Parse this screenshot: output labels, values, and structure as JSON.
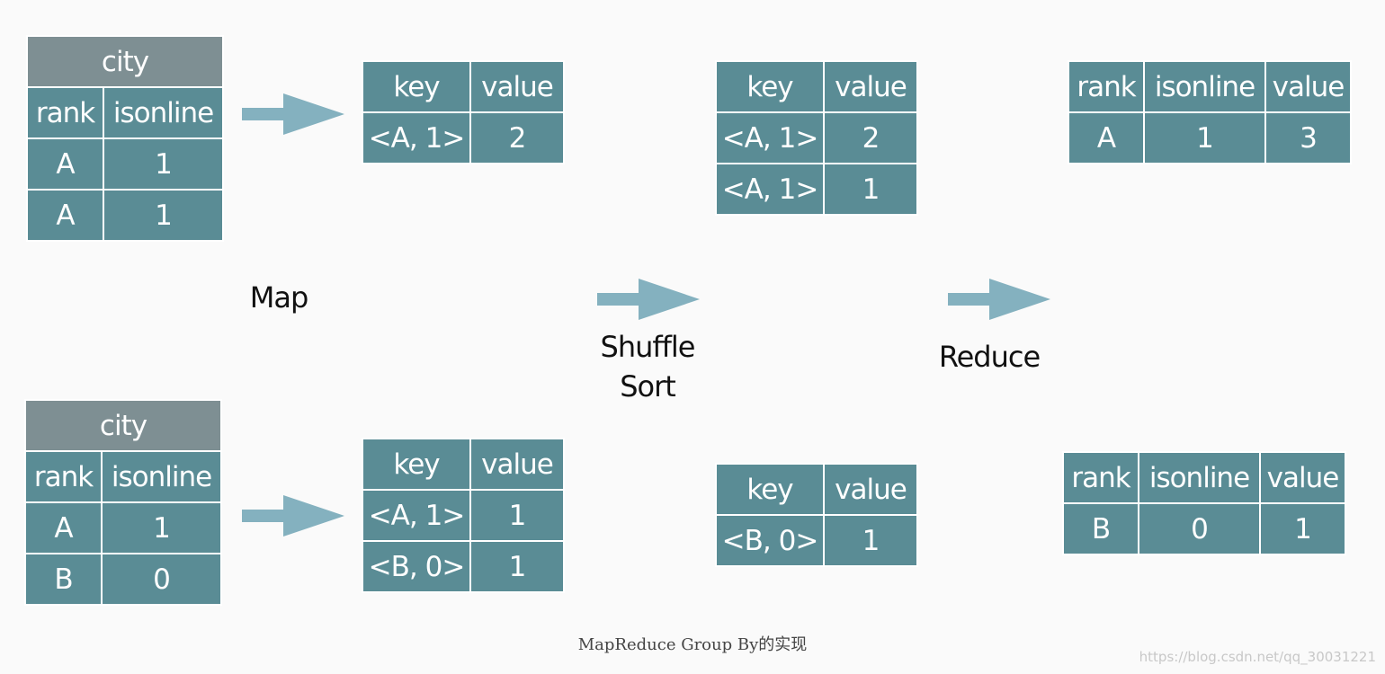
{
  "input_table_1": {
    "title": "city",
    "headers": [
      "rank",
      "isonline"
    ],
    "rows": [
      [
        "A",
        "1"
      ],
      [
        "A",
        "1"
      ]
    ]
  },
  "input_table_2": {
    "title": "city",
    "headers": [
      "rank",
      "isonline"
    ],
    "rows": [
      [
        "A",
        "1"
      ],
      [
        "B",
        "0"
      ]
    ]
  },
  "map_table_1": {
    "headers": [
      "key",
      "value"
    ],
    "rows": [
      [
        "<A, 1>",
        "2"
      ]
    ]
  },
  "map_table_2": {
    "headers": [
      "key",
      "value"
    ],
    "rows": [
      [
        "<A, 1>",
        "1"
      ],
      [
        "<B, 0>",
        "1"
      ]
    ]
  },
  "shuffle_table_1": {
    "headers": [
      "key",
      "value"
    ],
    "rows": [
      [
        "<A, 1>",
        "2"
      ],
      [
        "<A, 1>",
        "1"
      ]
    ]
  },
  "shuffle_table_2": {
    "headers": [
      "key",
      "value"
    ],
    "rows": [
      [
        "<B, 0>",
        "1"
      ]
    ]
  },
  "reduce_table_1": {
    "headers": [
      "rank",
      "isonline",
      "value"
    ],
    "rows": [
      [
        "A",
        "1",
        "3"
      ]
    ]
  },
  "reduce_table_2": {
    "headers": [
      "rank",
      "isonline",
      "value"
    ],
    "rows": [
      [
        "B",
        "0",
        "1"
      ]
    ]
  },
  "stages": {
    "map": "Map",
    "shuffle": "Shuffle",
    "sort": "Sort",
    "reduce": "Reduce"
  },
  "caption": "MapReduce Group By的实现",
  "watermark": "https://blog.csdn.net/qq_30031221",
  "colors": {
    "cell": "#5a8c95",
    "title_cell": "#7e8f93",
    "arrow": "#84b1bf",
    "background": "#fafafa"
  }
}
